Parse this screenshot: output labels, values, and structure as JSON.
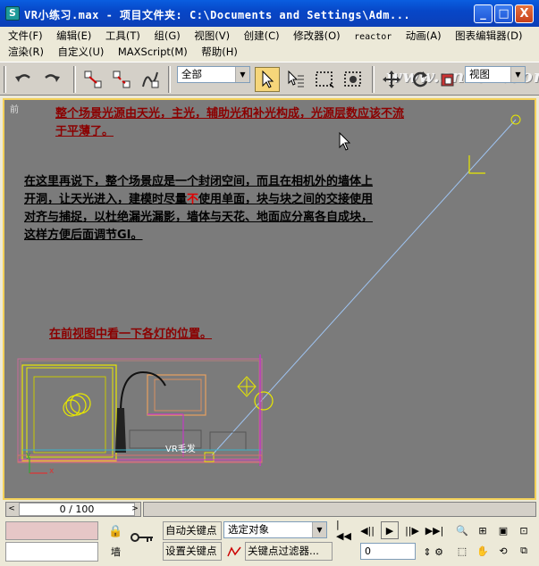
{
  "window": {
    "app_icon": "3ds-max-icon",
    "title": "VR小练习.max - 项目文件夹: C:\\Documents and Settings\\Adm...",
    "min": "_",
    "max": "□",
    "close": "X"
  },
  "menu": {
    "row1": [
      "文件(F)",
      "编辑(E)",
      "工具(T)",
      "组(G)",
      "视图(V)",
      "创建(C)",
      "修改器(O)",
      "reactor",
      "动画(A)",
      "图表编辑器(D)"
    ],
    "row2": [
      "渲染(R)",
      "自定义(U)",
      "MAXScript(M)",
      "帮助(H)"
    ]
  },
  "toolbar": {
    "selection_filter": "全部",
    "coord_system": "视图",
    "watermark": "www.snren.com",
    "icons": [
      "undo-icon",
      "redo-icon",
      "select-link-icon",
      "unlink-icon",
      "bind-space-warp-icon",
      "select-object-icon",
      "select-by-name-icon",
      "rect-region-icon",
      "window-crossing-icon",
      "move-icon",
      "rotate-icon",
      "scale-icon"
    ]
  },
  "viewport": {
    "label": "前",
    "note1": "整个场景光源由天光，主光，辅助光和补光构成，光源层数应该不流于平薄了。",
    "note2_before": "在这里再说下，整个场景应是一个封闭空间，而且在相机外的墙体上开洞，让天光进入，建模时尽量",
    "note2_highlight": "不",
    "note2_after": "使用单面，块与块之间的交接使用对齐与捕捉，以杜绝漏光漏影，墙体与天花、地面应分离各自成块，这样方便后面调节GI。",
    "note3": "在前视图中看一下各灯的位置。",
    "object_label": "VR毛发",
    "axis_x": "x",
    "axis_y": "y"
  },
  "timeline": {
    "position": "0 / 100",
    "left_arrow": "<",
    "right_arrow": ">"
  },
  "status": {
    "lock_label": "墙",
    "auto_key": "自动关键点",
    "set_key": "设置关键点",
    "key_mode": "选定对象",
    "key_filters": "关键点过滤器...",
    "frame": "0"
  }
}
